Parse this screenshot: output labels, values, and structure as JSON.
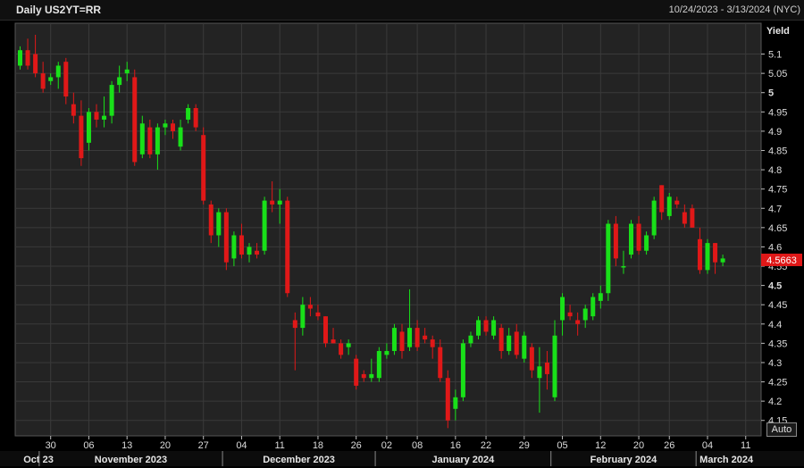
{
  "header": {
    "title": "Daily US2YT=RR",
    "date_range": "10/24/2023 - 3/13/2024 (NYC)"
  },
  "controls": {
    "auto_label": "Auto"
  },
  "colors": {
    "up": "#19e019",
    "down": "#e01818",
    "plot_bg": "#232323",
    "grid": "#3a3a3a",
    "last_price_bg": "#e01818"
  },
  "chart_data": {
    "type": "candlestick",
    "ylabel": "Yield",
    "ylim": [
      4.11,
      5.18
    ],
    "yticks": [
      {
        "v": 5.1,
        "label": "5.1"
      },
      {
        "v": 5.05,
        "label": "5.05"
      },
      {
        "v": 5.0,
        "label": "5"
      },
      {
        "v": 4.95,
        "label": "4.95"
      },
      {
        "v": 4.9,
        "label": "4.9"
      },
      {
        "v": 4.85,
        "label": "4.85"
      },
      {
        "v": 4.8,
        "label": "4.8"
      },
      {
        "v": 4.75,
        "label": "4.75"
      },
      {
        "v": 4.7,
        "label": "4.7"
      },
      {
        "v": 4.65,
        "label": "4.65"
      },
      {
        "v": 4.6,
        "label": "4.6"
      },
      {
        "v": 4.55,
        "label": "4.55"
      },
      {
        "v": 4.5,
        "label": "4.5"
      },
      {
        "v": 4.45,
        "label": "4.45"
      },
      {
        "v": 4.4,
        "label": "4.4"
      },
      {
        "v": 4.35,
        "label": "4.35"
      },
      {
        "v": 4.3,
        "label": "4.3"
      },
      {
        "v": 4.25,
        "label": "4.25"
      },
      {
        "v": 4.2,
        "label": "4.2"
      },
      {
        "v": 4.15,
        "label": "4.15"
      }
    ],
    "bold_ticks": [
      "5",
      "4.5"
    ],
    "last_price": {
      "value": 4.5663,
      "label": "4.5663"
    },
    "x_day_labels": [
      {
        "i": 4,
        "label": "30"
      },
      {
        "i": 9,
        "label": "06"
      },
      {
        "i": 14,
        "label": "13"
      },
      {
        "i": 19,
        "label": "20"
      },
      {
        "i": 24,
        "label": "27"
      },
      {
        "i": 29,
        "label": "04"
      },
      {
        "i": 34,
        "label": "11"
      },
      {
        "i": 39,
        "label": "18"
      },
      {
        "i": 44,
        "label": "26"
      },
      {
        "i": 48,
        "label": "02"
      },
      {
        "i": 52,
        "label": "08"
      },
      {
        "i": 57,
        "label": "16"
      },
      {
        "i": 61,
        "label": "22"
      },
      {
        "i": 66,
        "label": "29"
      },
      {
        "i": 71,
        "label": "05"
      },
      {
        "i": 76,
        "label": "12"
      },
      {
        "i": 81,
        "label": "20"
      },
      {
        "i": 85,
        "label": "26"
      },
      {
        "i": 90,
        "label": "04"
      },
      {
        "i": 95,
        "label": "11"
      }
    ],
    "months": [
      {
        "label": "Oct 23",
        "start": -0.5,
        "end": 2.5
      },
      {
        "label": "November 2023",
        "start": 2.5,
        "end": 26.5
      },
      {
        "label": "December 2023",
        "start": 26.5,
        "end": 46.5
      },
      {
        "label": "January 2024",
        "start": 46.5,
        "end": 69.5
      },
      {
        "label": "February 2024",
        "start": 69.5,
        "end": 88.5
      },
      {
        "label": "March 2024",
        "start": 88.5,
        "end": 97.5
      }
    ],
    "ohlc": [
      [
        5.07,
        5.12,
        5.06,
        5.11
      ],
      [
        5.11,
        5.14,
        5.06,
        5.07
      ],
      [
        5.1,
        5.15,
        5.04,
        5.05
      ],
      [
        5.05,
        5.08,
        5.0,
        5.01
      ],
      [
        5.03,
        5.05,
        5.02,
        5.04
      ],
      [
        5.04,
        5.08,
        5.01,
        5.07
      ],
      [
        5.08,
        5.09,
        4.97,
        4.99
      ],
      [
        4.97,
        5.0,
        4.92,
        4.94
      ],
      [
        4.94,
        4.98,
        4.81,
        4.83
      ],
      [
        4.87,
        4.96,
        4.85,
        4.95
      ],
      [
        4.95,
        4.97,
        4.91,
        4.93
      ],
      [
        4.93,
        4.99,
        4.91,
        4.94
      ],
      [
        4.94,
        5.03,
        4.92,
        5.02
      ],
      [
        5.02,
        5.07,
        5.0,
        5.04
      ],
      [
        5.05,
        5.08,
        5.03,
        5.06
      ],
      [
        5.04,
        5.06,
        4.81,
        4.82
      ],
      [
        4.84,
        4.94,
        4.83,
        4.92
      ],
      [
        4.91,
        4.93,
        4.83,
        4.84
      ],
      [
        4.84,
        4.92,
        4.8,
        4.91
      ],
      [
        4.91,
        4.93,
        4.89,
        4.92
      ],
      [
        4.92,
        4.93,
        4.88,
        4.9
      ],
      [
        4.86,
        4.93,
        4.85,
        4.91
      ],
      [
        4.93,
        4.97,
        4.92,
        4.96
      ],
      [
        4.96,
        4.97,
        4.9,
        4.91
      ],
      [
        4.89,
        4.91,
        4.71,
        4.72
      ],
      [
        4.71,
        4.72,
        4.61,
        4.63
      ],
      [
        4.63,
        4.7,
        4.6,
        4.69
      ],
      [
        4.69,
        4.7,
        4.54,
        4.56
      ],
      [
        4.57,
        4.64,
        4.55,
        4.63
      ],
      [
        4.63,
        4.66,
        4.57,
        4.58
      ],
      [
        4.58,
        4.61,
        4.56,
        4.6
      ],
      [
        4.59,
        4.61,
        4.57,
        4.58
      ],
      [
        4.59,
        4.73,
        4.58,
        4.72
      ],
      [
        4.72,
        4.77,
        4.69,
        4.71
      ],
      [
        4.71,
        4.75,
        4.66,
        4.72
      ],
      [
        4.72,
        4.73,
        4.47,
        4.48
      ],
      [
        4.41,
        4.43,
        4.28,
        4.39
      ],
      [
        4.39,
        4.47,
        4.37,
        4.45
      ],
      [
        4.45,
        4.47,
        4.42,
        4.44
      ],
      [
        4.43,
        4.45,
        4.41,
        4.42
      ],
      [
        4.42,
        4.42,
        4.34,
        4.35
      ],
      [
        4.36,
        4.39,
        4.35,
        4.35
      ],
      [
        4.35,
        4.36,
        4.31,
        4.32
      ],
      [
        4.34,
        4.36,
        4.32,
        4.35
      ],
      [
        4.31,
        4.32,
        4.23,
        4.24
      ],
      [
        4.27,
        4.28,
        4.25,
        4.26
      ],
      [
        4.26,
        4.31,
        4.25,
        4.27
      ],
      [
        4.26,
        4.34,
        4.25,
        4.33
      ],
      [
        4.32,
        4.35,
        4.31,
        4.33
      ],
      [
        4.33,
        4.4,
        4.32,
        4.39
      ],
      [
        4.38,
        4.4,
        4.31,
        4.33
      ],
      [
        4.34,
        4.49,
        4.33,
        4.39
      ],
      [
        4.39,
        4.41,
        4.33,
        4.34
      ],
      [
        4.37,
        4.39,
        4.35,
        4.36
      ],
      [
        4.36,
        4.37,
        4.31,
        4.34
      ],
      [
        4.34,
        4.36,
        4.25,
        4.26
      ],
      [
        4.26,
        4.28,
        4.13,
        4.15
      ],
      [
        4.18,
        4.23,
        4.15,
        4.21
      ],
      [
        4.21,
        4.36,
        4.2,
        4.35
      ],
      [
        4.35,
        4.38,
        4.34,
        4.37
      ],
      [
        4.37,
        4.42,
        4.36,
        4.41
      ],
      [
        4.41,
        4.42,
        4.37,
        4.38
      ],
      [
        4.37,
        4.42,
        4.36,
        4.41
      ],
      [
        4.39,
        4.4,
        4.31,
        4.33
      ],
      [
        4.33,
        4.39,
        4.32,
        4.37
      ],
      [
        4.38,
        4.4,
        4.31,
        4.32
      ],
      [
        4.31,
        4.38,
        4.3,
        4.37
      ],
      [
        4.34,
        4.35,
        4.26,
        4.28
      ],
      [
        4.26,
        4.34,
        4.17,
        4.29
      ],
      [
        4.3,
        4.33,
        4.23,
        4.27
      ],
      [
        4.21,
        4.41,
        4.2,
        4.37
      ],
      [
        4.41,
        4.48,
        4.37,
        4.47
      ],
      [
        4.43,
        4.45,
        4.41,
        4.42
      ],
      [
        4.41,
        4.43,
        4.37,
        4.4
      ],
      [
        4.41,
        4.45,
        4.39,
        4.44
      ],
      [
        4.42,
        4.48,
        4.41,
        4.47
      ],
      [
        4.46,
        4.5,
        4.44,
        4.48
      ],
      [
        4.48,
        4.67,
        4.46,
        4.66
      ],
      [
        4.66,
        4.68,
        4.55,
        4.57
      ],
      [
        4.55,
        4.59,
        4.53,
        4.55
      ],
      [
        4.58,
        4.67,
        4.57,
        4.66
      ],
      [
        4.66,
        4.68,
        4.58,
        4.59
      ],
      [
        4.59,
        4.64,
        4.58,
        4.63
      ],
      [
        4.63,
        4.73,
        4.62,
        4.72
      ],
      [
        4.76,
        4.76,
        4.67,
        4.69
      ],
      [
        4.68,
        4.74,
        4.67,
        4.73
      ],
      [
        4.72,
        4.73,
        4.7,
        4.71
      ],
      [
        4.69,
        4.71,
        4.65,
        4.66
      ],
      [
        4.7,
        4.71,
        4.65,
        4.65
      ],
      [
        4.62,
        4.65,
        4.53,
        4.54
      ],
      [
        4.54,
        4.62,
        4.53,
        4.61
      ],
      [
        4.61,
        4.61,
        4.53,
        4.56
      ],
      [
        4.56,
        4.58,
        4.55,
        4.57
      ]
    ]
  }
}
